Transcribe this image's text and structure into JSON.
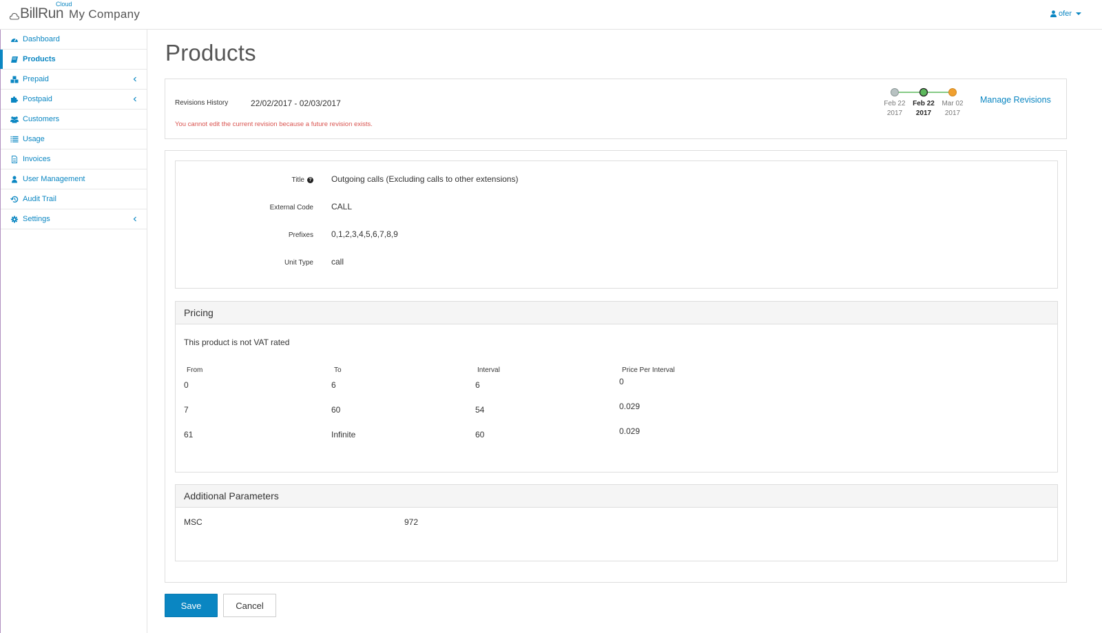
{
  "header": {
    "brand": "BillRun",
    "brand_sup": "Cloud",
    "company": "My Company",
    "user": "ofer"
  },
  "sidebar": {
    "items": [
      {
        "label": "Dashboard",
        "icon": "dashboard-icon"
      },
      {
        "label": "Products",
        "icon": "book-icon",
        "active": true
      },
      {
        "label": "Prepaid",
        "icon": "cubes-icon",
        "has_children": true
      },
      {
        "label": "Postpaid",
        "icon": "puzzle-icon",
        "has_children": true
      },
      {
        "label": "Customers",
        "icon": "users-icon"
      },
      {
        "label": "Usage",
        "icon": "list-icon"
      },
      {
        "label": "Invoices",
        "icon": "file-icon"
      },
      {
        "label": "User Management",
        "icon": "user-icon"
      },
      {
        "label": "Audit Trail",
        "icon": "history-icon"
      },
      {
        "label": "Settings",
        "icon": "gear-icon",
        "has_children": true
      }
    ]
  },
  "page": {
    "title": "Products"
  },
  "revisions": {
    "label": "Revisions History",
    "range": "22/02/2017 - 02/03/2017",
    "error": "You cannot edit the current revision because a future revision exists.",
    "manage_label": "Manage Revisions",
    "timeline": [
      {
        "date": "Feb 22",
        "year": "2017",
        "status": "past",
        "color": "#b8c2c2"
      },
      {
        "date": "Feb 22",
        "year": "2017",
        "status": "current",
        "color": "#5cb85c"
      },
      {
        "date": "Mar 02",
        "year": "2017",
        "status": "future",
        "color": "#f0a030"
      }
    ]
  },
  "details": {
    "title_label": "Title",
    "title_value": "Outgoing calls (Excluding calls to other extensions)",
    "external_code_label": "External Code",
    "external_code_value": "CALL",
    "prefixes_label": "Prefixes",
    "prefixes_value": "0,1,2,3,4,5,6,7,8,9",
    "unit_type_label": "Unit Type",
    "unit_type_value": "call"
  },
  "pricing": {
    "heading": "Pricing",
    "vat_note": "This product is not VAT rated",
    "columns": [
      "From",
      "To",
      "Interval",
      "Price Per Interval"
    ],
    "rows": [
      [
        "0",
        "6",
        "6",
        "0"
      ],
      [
        "7",
        "60",
        "54",
        "0.029"
      ],
      [
        "61",
        "Infinite",
        "60",
        "0.029"
      ]
    ]
  },
  "additional": {
    "heading": "Additional Parameters",
    "params": [
      {
        "name": "MSC",
        "value": "972"
      }
    ]
  },
  "actions": {
    "save": "Save",
    "cancel": "Cancel"
  },
  "colors": {
    "accent": "#0a86c2",
    "error": "#d9534f"
  }
}
